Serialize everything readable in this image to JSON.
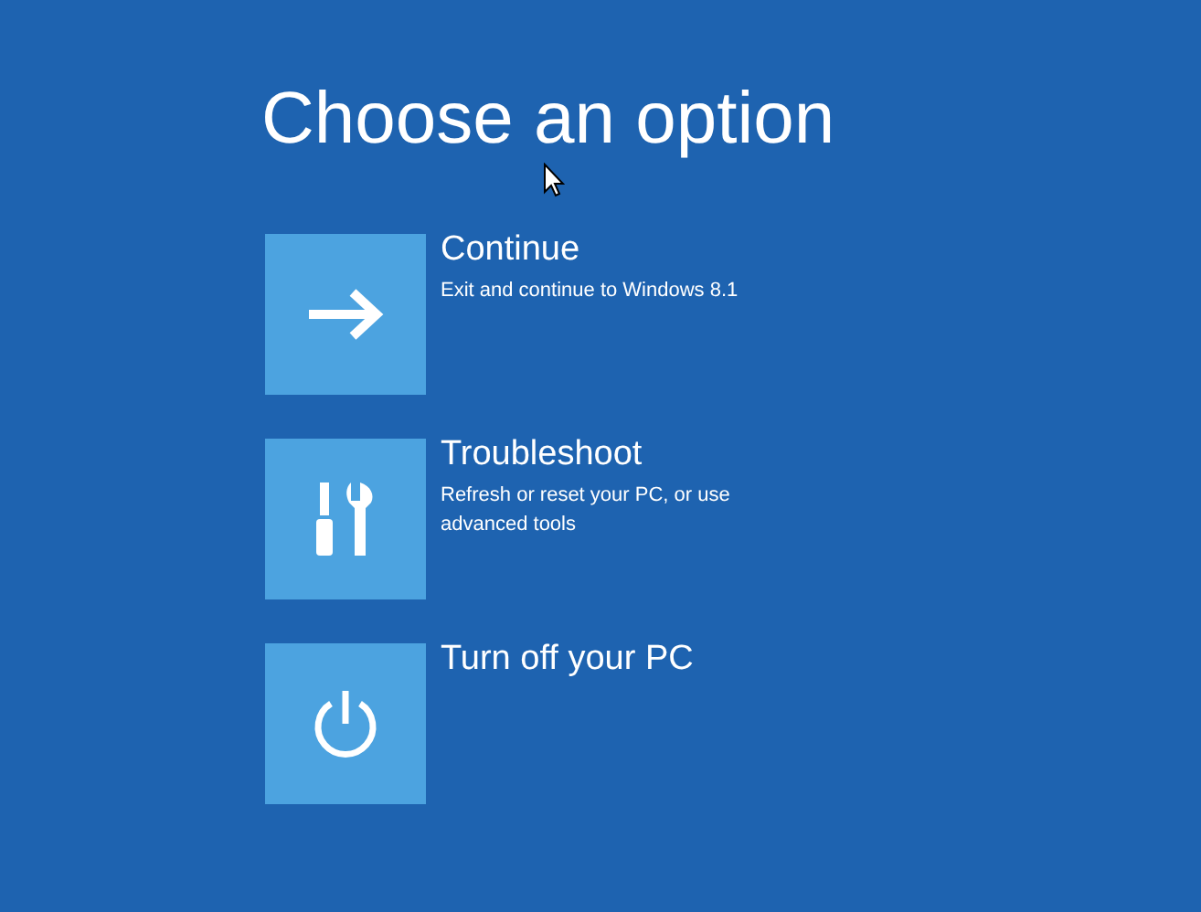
{
  "title": "Choose an option",
  "options": [
    {
      "kind": "continue",
      "label": "Continue",
      "description": "Exit and continue to Windows 8.1"
    },
    {
      "kind": "troubleshoot",
      "label": "Troubleshoot",
      "description": "Refresh or reset your PC, or use advanced tools"
    },
    {
      "kind": "power",
      "label": "Turn off your PC"
    }
  ]
}
